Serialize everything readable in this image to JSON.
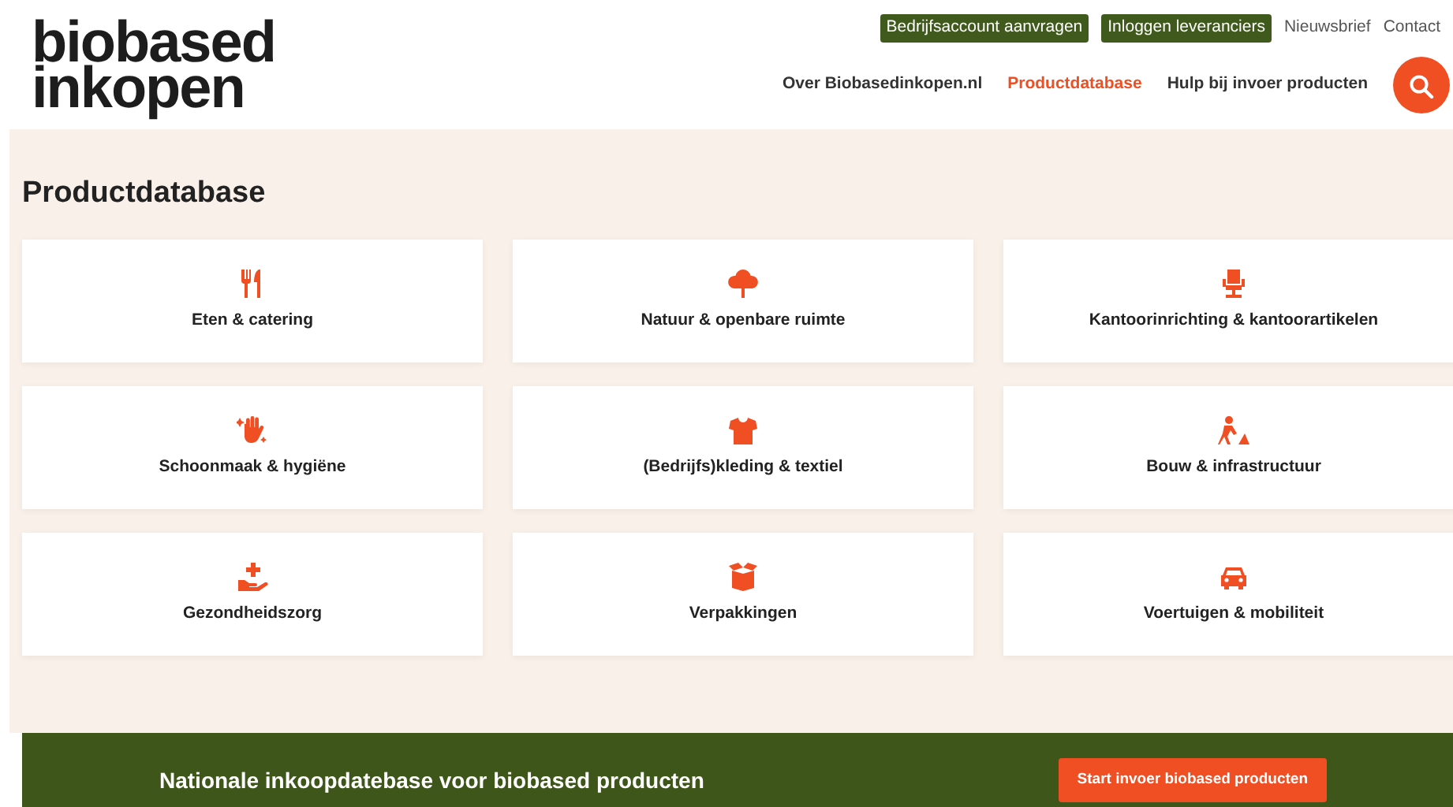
{
  "logo": {
    "lines": [
      "biobased",
      "inkopen"
    ]
  },
  "top_links": [
    {
      "label": "Bedrijfsaccount aanvragen",
      "kind": "badge"
    },
    {
      "label": "Inloggen leveranciers",
      "kind": "badge"
    },
    {
      "label": "Nieuwsbrief",
      "kind": "plain"
    },
    {
      "label": "Contact",
      "kind": "plain"
    }
  ],
  "main_nav": [
    {
      "label": "Over Biobasedinkopen.nl",
      "selected": false
    },
    {
      "label": "Productdatabase",
      "selected": true
    },
    {
      "label": "Hulp bij invoer producten",
      "selected": false
    }
  ],
  "page_title": "Productdatabase",
  "categories": [
    {
      "label": "Eten & catering"
    },
    {
      "label": "Natuur & openbare ruimte"
    },
    {
      "label": "Kantoorinrichting & kantoorartikelen"
    },
    {
      "label": "Schoonmaak & hygiëne"
    },
    {
      "label": "(Bedrijfs)kleding & textiel"
    },
    {
      "label": "Bouw & infrastructuur"
    },
    {
      "label": "Gezondheidszorg"
    },
    {
      "label": "Verpakkingen"
    },
    {
      "label": "Voertuigen & mobiliteit"
    }
  ],
  "banner": {
    "text": "Nationale inkoopdatebase voor biobased producten",
    "button": "Start invoer biobased producten"
  }
}
